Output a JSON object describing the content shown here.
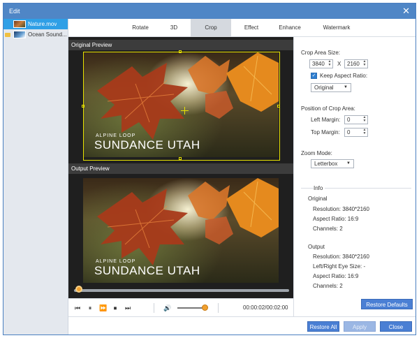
{
  "window": {
    "title": "Edit",
    "close_glyph": "✕"
  },
  "files": [
    {
      "name": "Nature.mov",
      "selected": true
    },
    {
      "name": "Ocean Sound...",
      "selected": false
    }
  ],
  "tabs": [
    "Rotate",
    "3D",
    "Crop",
    "Effect",
    "Enhance",
    "Watermark"
  ],
  "active_tab": "Crop",
  "preview": {
    "original_label": "Original Preview",
    "output_label": "Output Preview",
    "video_title_small": "ALPINE LOOP",
    "video_title_large": "SUNDANCE UTAH"
  },
  "player": {
    "time": "00:00:02/00:02:00",
    "icons": [
      "skip-back-icon",
      "pause-icon",
      "fast-forward-icon",
      "stop-icon",
      "skip-forward-icon",
      "volume-icon"
    ]
  },
  "crop": {
    "size_label": "Crop Area Size:",
    "width": "3840",
    "x_separator": "X",
    "height": "2160",
    "keep_aspect_label": "Keep Aspect Ratio:",
    "keep_aspect_checked": true,
    "aspect_option": "Original",
    "position_label": "Position of Crop Area:",
    "left_margin_label": "Left Margin:",
    "left_margin": "0",
    "top_margin_label": "Top Margin:",
    "top_margin": "0",
    "zoom_label": "Zoom Mode:",
    "zoom_option": "Letterbox"
  },
  "info": {
    "header": "Info",
    "original_header": "Original",
    "orig_resolution": "Resolution: 3840*2160",
    "orig_aspect": "Aspect Ratio: 16:9",
    "orig_channels": "Channels: 2",
    "output_header": "Output",
    "out_resolution": "Resolution: 3840*2160",
    "out_eye_size": "Left/Right Eye Size: -",
    "out_aspect": "Aspect Ratio: 16:9",
    "out_channels": "Channels: 2"
  },
  "buttons": {
    "restore_defaults": "Restore Defaults",
    "restore_all": "Restore All",
    "apply": "Apply",
    "close": "Close"
  },
  "colors": {
    "accent": "#4f86c6",
    "button": "#4a7fd4",
    "crop_frame": "#e8e300",
    "knob": "#f0a030"
  }
}
